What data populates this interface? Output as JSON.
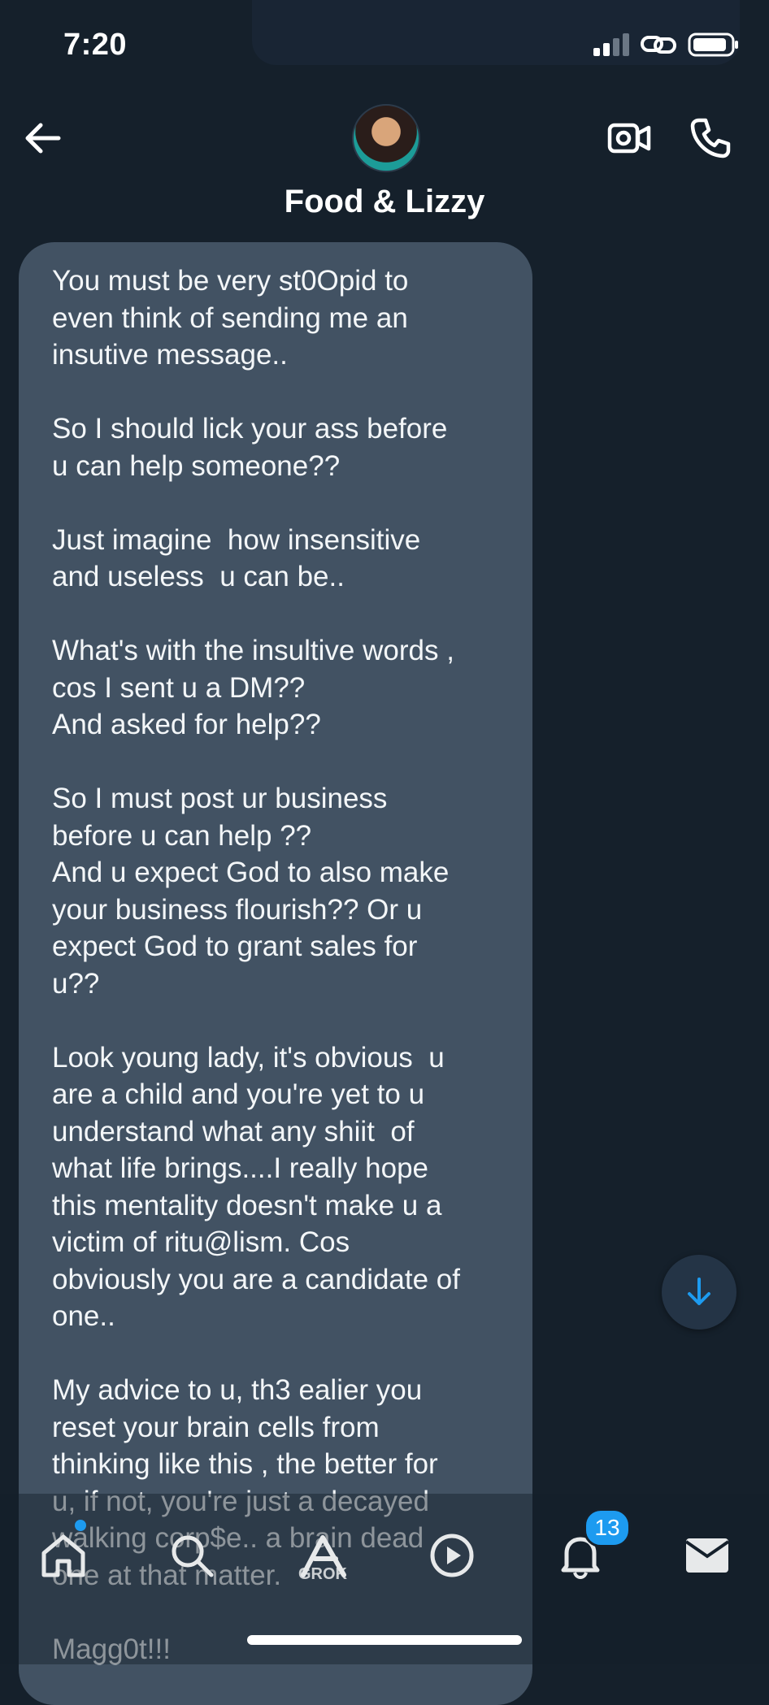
{
  "status_bar": {
    "time": "7:20"
  },
  "header": {
    "title": "Food & Lizzy"
  },
  "message": {
    "text": "You must be very st0Opid to\neven think of sending me an\ninsutive message..\n\nSo I should lick your ass before\nu can help someone??\n\nJust imagine  how insensitive\nand useless  u can be..\n\nWhat's with the insultive words ,\ncos I sent u a DM??\nAnd asked for help??\n\nSo I must post ur business\nbefore u can help ??\nAnd u expect God to also make\nyour business flourish?? Or u\nexpect God to grant sales for\nu??\n\nLook young lady, it's obvious  u\nare a child and you're yet to u\nunderstand what any shiit  of\nwhat life brings....I really hope\nthis mentality doesn't make u a\nvictim of ritu@lism. Cos\nobviously you are a candidate of\none..\n\nMy advice to u, th3 ealier you\nreset your brain cells from\nthinking like this , the better for\nu, if not, you're just a decayed\nwalking corp$e.. a brain dead\none at that matter.\n\nMagg0t!!!"
  },
  "tabbar": {
    "notifications_badge": "13",
    "grok_label": "GROK"
  },
  "colors": {
    "background": "#15202b",
    "bubble": "#425263",
    "accent": "#1d9bf0"
  },
  "icons": {
    "back": "arrow-left-icon",
    "video": "video-camera-icon",
    "call": "phone-icon",
    "scroll": "arrow-down-icon",
    "home": "home-icon",
    "search": "search-icon",
    "grok": "grok-icon",
    "media": "play-icon",
    "notifications": "bell-icon",
    "messages": "envelope-icon"
  }
}
